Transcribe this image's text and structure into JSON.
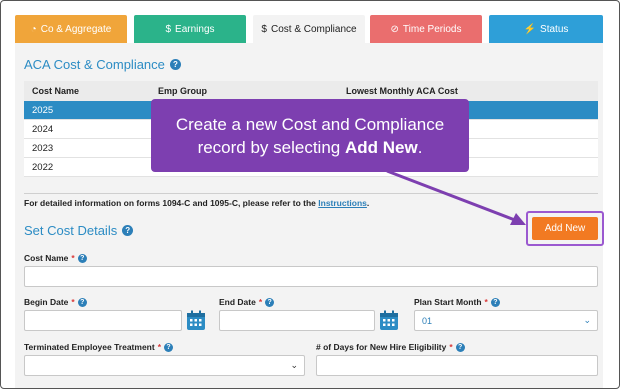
{
  "tabs": [
    {
      "label": "Co & Aggregate",
      "icon": "pie-chart-icon",
      "glyph": "◔"
    },
    {
      "label": "Earnings",
      "icon": "dollar-icon",
      "glyph": "$"
    },
    {
      "label": "Cost & Compliance",
      "icon": "dollar-icon",
      "glyph": "$"
    },
    {
      "label": "Time Periods",
      "icon": "clock-icon",
      "glyph": "⊘"
    },
    {
      "label": "Status",
      "icon": "bolt-icon",
      "glyph": "⚡"
    }
  ],
  "section1": {
    "title": "ACA Cost & Compliance",
    "help": "?"
  },
  "table": {
    "headers": [
      "Cost Name",
      "Emp Group",
      "Lowest Monthly ACA Cost"
    ],
    "rows": [
      "2025",
      "2024",
      "2023",
      "2022"
    ],
    "selected_index": 0
  },
  "info": {
    "text": "For detailed information on forms 1094-C and 1095-C, please refer to the ",
    "link": "Instructions",
    "end": "."
  },
  "section2": {
    "title": "Set Cost Details",
    "help": "?"
  },
  "add_new_label": "Add New",
  "fields": {
    "cost_name": {
      "label": "Cost Name",
      "value": ""
    },
    "begin_date": {
      "label": "Begin Date",
      "value": ""
    },
    "end_date": {
      "label": "End Date",
      "value": ""
    },
    "plan_start_month": {
      "label": "Plan Start Month",
      "value": "01"
    },
    "terminated_treatment": {
      "label": "Terminated Employee Treatment",
      "value": ""
    },
    "new_hire_days": {
      "label": "# of Days for New Hire Eligibility",
      "value": ""
    }
  },
  "required_mark": "*",
  "callout": {
    "line1": "Create a new Cost and Compliance",
    "line2_pre": "record by selecting ",
    "line2_bold": "Add New",
    "line2_end": "."
  },
  "colors": {
    "accent_blue": "#2c8cc4",
    "callout_purple": "#7d3fb0",
    "add_new_orange": "#f27a22"
  }
}
